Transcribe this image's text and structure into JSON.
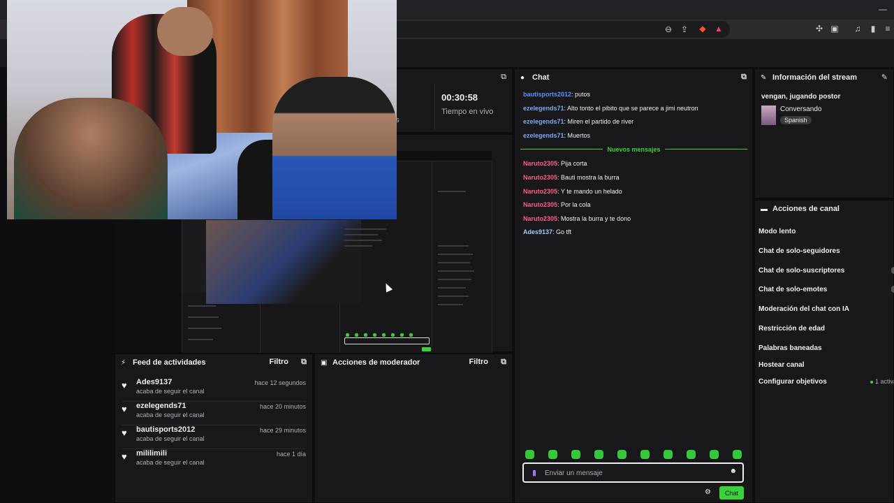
{
  "stats": {
    "uptime": "00:30:58",
    "uptime_label": "Tiempo en vivo",
    "cut_label": "es"
  },
  "panels": {
    "chat_title": "Chat",
    "stream_info_title": "Información del stream",
    "channel_actions_title": "Acciones de canal",
    "feed_title": "Feed de actividades",
    "mod_actions_title": "Acciones de moderador",
    "filter_label": "Filtro"
  },
  "feed": [
    {
      "name": "Ades9137",
      "sub": "acaba de seguir el canal",
      "time": "hace 12 segundos"
    },
    {
      "name": "ezelegends71",
      "sub": "acaba de seguir el canal",
      "time": "hace 20 minutos"
    },
    {
      "name": "bautisports2012",
      "sub": "acaba de seguir el canal",
      "time": "hace 29 minutos"
    },
    {
      "name": "mililimili",
      "sub": "acaba de seguir el canal",
      "time": "hace 1 día"
    }
  ],
  "chat": {
    "messages": [
      {
        "user": "bautisports2012",
        "color": "#5b8ff9",
        "text": ": putos"
      },
      {
        "user": "ezelegends71",
        "color": "#7da7f0",
        "text": ": Alto tonto el pibito que se parece a jimi neutron"
      },
      {
        "user": "ezelegends71",
        "color": "#7da7f0",
        "text": ": Miren el partido de river"
      },
      {
        "user": "ezelegends71",
        "color": "#7da7f0",
        "text": ": Muertos"
      },
      {
        "user": "Naruto2305",
        "color": "#ff5c8a",
        "text": ": Pija corta"
      },
      {
        "user": "Naruto2305",
        "color": "#ff5c8a",
        "text": ": Bauti mostra la burra"
      },
      {
        "user": "Naruto2305",
        "color": "#ff5c8a",
        "text": ": Y te mando un helado"
      },
      {
        "user": "Naruto2305",
        "color": "#ff5c8a",
        "text": ": Por la cola"
      },
      {
        "user": "Naruto2305",
        "color": "#ff5c8a",
        "text": ": Mostra la burra y te dono"
      },
      {
        "user": "Ades9137",
        "color": "#9ecbff",
        "text": ": Go tft"
      }
    ],
    "new_messages_label": "Nuevos mensajes",
    "input_placeholder": "Enviar un mensaje",
    "send_label": "Chat"
  },
  "stream_info": {
    "title": "vengan, jugando postor",
    "category": "Conversando",
    "tag": "Spanish"
  },
  "channel_actions": [
    "Modo lento",
    "Chat de solo-seguidores",
    "Chat de solo-suscriptores",
    "Chat de solo-emotes",
    "Moderación del chat con IA",
    "Restricción de edad",
    "Palabras baneadas",
    "Hostear canal",
    "Configurar objetivos"
  ],
  "goals_active": "1 activa",
  "colors": {
    "accent": "#3ad13a",
    "panel": "#18181b",
    "bg": "#0e0e10"
  },
  "icons": {
    "chat": "chat-bubble-icon",
    "pencil": "pencil-icon",
    "popout": "popout-icon",
    "heart": "heart-icon",
    "gear": "gear-icon",
    "mic": "mic-icon",
    "emoji": "emoji-icon"
  }
}
